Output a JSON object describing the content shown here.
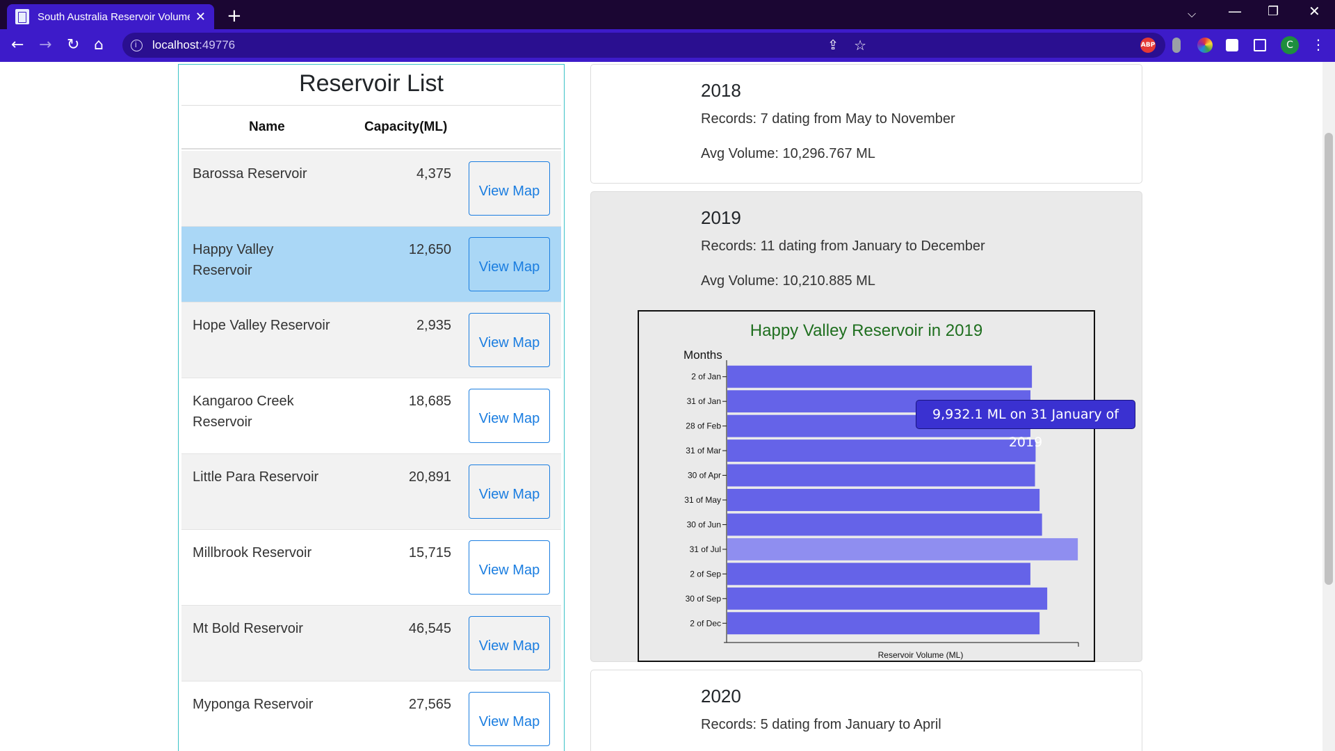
{
  "browser": {
    "tab_title": "South Australia Reservoir Volume",
    "url_host": "localhost",
    "url_port": ":49776",
    "extensions": [
      "adblock-icon",
      "extension-icon",
      "color-picker-icon",
      "puzzle-icon"
    ],
    "profile_initial": "C"
  },
  "reservoir_list": {
    "title": "Reservoir List",
    "headers": {
      "name": "Name",
      "capacity": "Capacity(ML)"
    },
    "button_label": "View Map",
    "rows": [
      {
        "name": "Barossa Reservoir",
        "capacity": "4,375"
      },
      {
        "name": "Happy Valley Reservoir",
        "capacity": "12,650"
      },
      {
        "name": "Hope Valley Reservoir",
        "capacity": "2,935"
      },
      {
        "name": "Kangaroo Creek Reservoir",
        "capacity": "18,685"
      },
      {
        "name": "Little Para Reservoir",
        "capacity": "20,891"
      },
      {
        "name": "Millbrook Reservoir",
        "capacity": "15,715"
      },
      {
        "name": "Mt Bold Reservoir",
        "capacity": "46,545"
      },
      {
        "name": "Myponga Reservoir",
        "capacity": "27,565"
      }
    ],
    "selected_index": 1
  },
  "years": [
    {
      "year": "2018",
      "records": "Records: 7 dating from May to November",
      "avg": "Avg Volume: 10,296.767 ML"
    },
    {
      "year": "2019",
      "records": "Records: 11 dating from January to December",
      "avg": "Avg Volume: 10,210.885 ML"
    },
    {
      "year": "2020",
      "records": "Records: 5 dating from January to April",
      "avg": ""
    }
  ],
  "tooltip": "9,932.1 ML on 31 January of 2019",
  "chart_data": {
    "type": "bar",
    "orientation": "horizontal",
    "title": "Happy Valley Reservoir in 2019",
    "ylabel": "Months",
    "xlabel": "Reservoir Volume (ML)",
    "categories": [
      "2 of Jan",
      "31 of Jan",
      "28 of Feb",
      "31 of Mar",
      "30 of Apr",
      "31 of May",
      "30 of Jun",
      "31 of Jul",
      "2 of Sep",
      "30 of Sep",
      "2 of Dec"
    ],
    "values": [
      9980,
      9932.1,
      9930,
      10100,
      10080,
      10230,
      10310,
      11480,
      9930,
      10480,
      10230
    ],
    "xlim": [
      0,
      11500
    ],
    "highlight_index": 7,
    "colors": {
      "bar": "#6563e8",
      "highlight": "#8f8ef0"
    }
  }
}
